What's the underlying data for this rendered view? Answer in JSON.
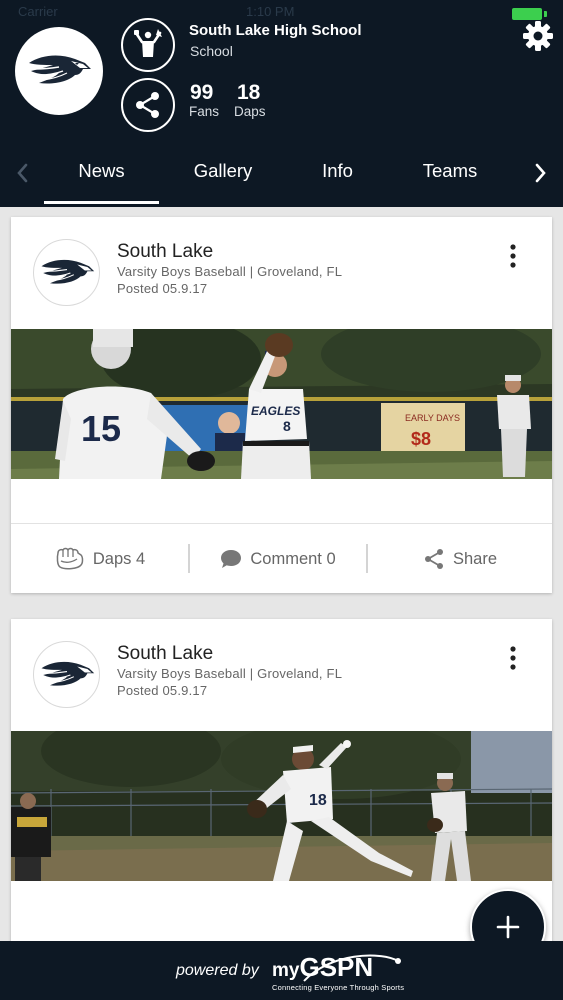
{
  "status": {
    "carrier": "Carrier",
    "time": "1:10 PM"
  },
  "profile": {
    "name": "South Lake High School",
    "type": "School",
    "fans_count": "99",
    "fans_label": "Fans",
    "daps_count": "18",
    "daps_label": "Daps",
    "logo_icon": "eagle-logo-icon"
  },
  "tabs": [
    {
      "label": "News",
      "active": true
    },
    {
      "label": "Gallery",
      "active": false
    },
    {
      "label": "Info",
      "active": false
    },
    {
      "label": "Teams",
      "active": false
    }
  ],
  "posts": [
    {
      "author": "South Lake",
      "subtitle": "Varsity Boys Baseball | Groveland, FL",
      "posted": "Posted 05.9.17",
      "daps_label": "Daps 4",
      "comment_label": "Comment 0",
      "share_label": "Share",
      "photo": "baseball-fielder-catch-photo"
    },
    {
      "author": "South Lake",
      "subtitle": "Varsity Boys Baseball | Groveland, FL",
      "posted": "Posted 05.9.17",
      "photo": "baseball-pitcher-throw-photo"
    }
  ],
  "footer": {
    "powered_by": "powered by",
    "brand_prefix": "my",
    "brand_name": "GSPN",
    "tagline": "Connecting Everyone Through Sports"
  },
  "colors": {
    "header_bg": "#0d1824",
    "background": "#e6e6e6",
    "card_bg": "#ffffff",
    "battery": "#3ccf4e"
  }
}
